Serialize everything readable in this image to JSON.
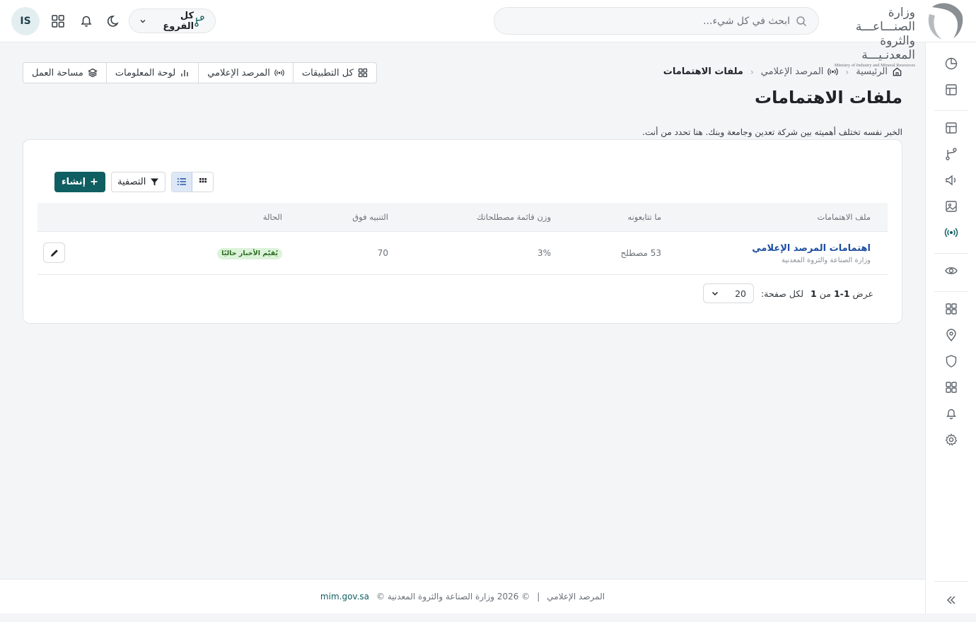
{
  "header": {
    "logo_line1": "وزارة الصنـــاعـــة",
    "logo_line2": "والثروة المعدنـيـــة",
    "logo_en": "Ministry of Industry and Mineral Resources",
    "search_placeholder": "ابحث في كل شيء...",
    "branch_select": "كل الفروع",
    "avatar_initials": "IS"
  },
  "breadcrumb": {
    "home": "الرئيسية",
    "section": "المرصد الإعلامي",
    "current": "ملفات الاهتمامات"
  },
  "page": {
    "title": "ملفات الاهتمامات",
    "description": "الخبر نفسه تختلف أهميته بين شركة تعدين وجامعة وبنك. هنا تحدد من أنت."
  },
  "quick_links": [
    "كل التطبيقات",
    "المرصد الإعلامي",
    "لوحة المعلومات",
    "مساحة العمل"
  ],
  "toolbar": {
    "create_label": "إنشاء",
    "filter_label": "التصفية"
  },
  "table": {
    "headers": {
      "profile": "ملف الاهتمامات",
      "following": "ما تتابعونه",
      "weight": "وزن قائمة مصطلحاتك",
      "alert_above": "التنبيه فوق",
      "status": "الحالة"
    },
    "rows": [
      {
        "title": "اهتمامات المرصد الإعلامي",
        "subtitle": "وزارة الصناعة والثروة المعدنية",
        "following": "53 مصطلح",
        "weight": "3%",
        "alert_above": "70",
        "status": "يُقيّم الأخبار حاليًا"
      }
    ]
  },
  "pagination": {
    "showing_prefix": "عرض",
    "range": "1-1",
    "of": "من",
    "total": "1",
    "per_page_label": "لكل صفحة:",
    "per_page": "20"
  },
  "footer": {
    "app": "المرصد الإعلامي",
    "separator": "|",
    "copyright": "© 2026 وزارة الصناعة والثروة المعدنية ©",
    "link": "mim.gov.sa"
  },
  "colors": {
    "primary": "#0f5e61",
    "link": "#1d4ea0",
    "status_bg": "#dcf3d9"
  }
}
